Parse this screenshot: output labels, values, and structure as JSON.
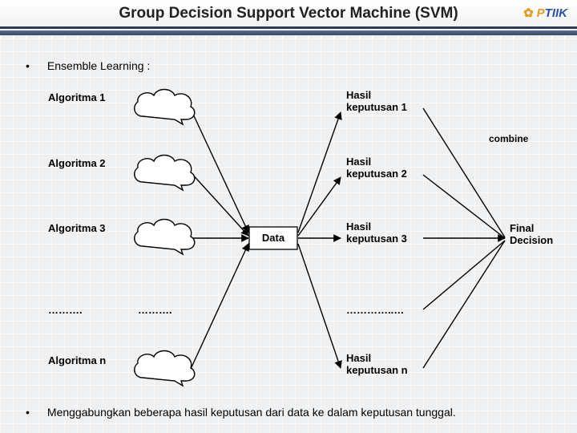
{
  "title": "Group Decision Support Vector Machine (SVM)",
  "logo": {
    "left": "P",
    "right": "TIIK"
  },
  "bullets": {
    "top": "Ensemble Learning :",
    "bottom": "Menggabungkan beberapa hasil keputusan dari data ke dalam keputusan tunggal."
  },
  "algos": {
    "a1": "Algoritma 1",
    "a2": "Algoritma 2",
    "a3": "Algoritma 3",
    "dots": "……….",
    "an": "Algoritma n"
  },
  "clouds": {
    "dots": "……….",
    "data": "Data"
  },
  "results": {
    "r1a": "Hasil",
    "r1b": "keputusan 1",
    "r2a": "Hasil",
    "r2b": "keputusan 2",
    "r3a": "Hasil",
    "r3b": "keputusan 3",
    "rdots": "…………..…",
    "rna": "Hasil",
    "rnb": "keputusan n"
  },
  "combine": "combine",
  "final": {
    "a": "Final",
    "b": "Decision"
  }
}
